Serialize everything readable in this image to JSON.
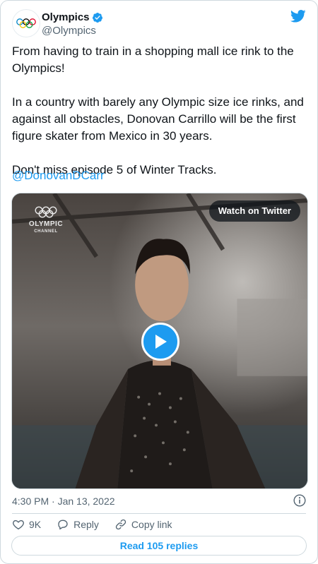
{
  "user": {
    "display_name": "Olympics",
    "handle": "@Olympics",
    "verified_icon": "verified-badge-icon",
    "avatar_icon": "olympic-rings-icon"
  },
  "tweet": {
    "text": "From having to train in a shopping mall ice rink to the Olympics!\n\nIn a country with barely any Olympic size ice rinks, and against all obstacles, Donovan Carrillo will be the first figure skater from Mexico in 30 years.\n\nDon't miss episode 5 of Winter Tracks.\n\n",
    "mention": "@DonovanDCarr",
    "timestamp": "4:30 PM · Jan 13, 2022"
  },
  "media": {
    "watch_label": "Watch on Twitter",
    "channel_word1": "OLYMPIC",
    "channel_word2": "CHANNEL",
    "play_icon": "play-icon"
  },
  "actions": {
    "like_count": "9K",
    "reply_label": "Reply",
    "copy_label": "Copy link"
  },
  "read_replies": "Read 105 replies",
  "colors": {
    "accent": "#1d9bf0",
    "text": "#0f1419",
    "muted": "#536471",
    "border": "#cfd9de"
  }
}
